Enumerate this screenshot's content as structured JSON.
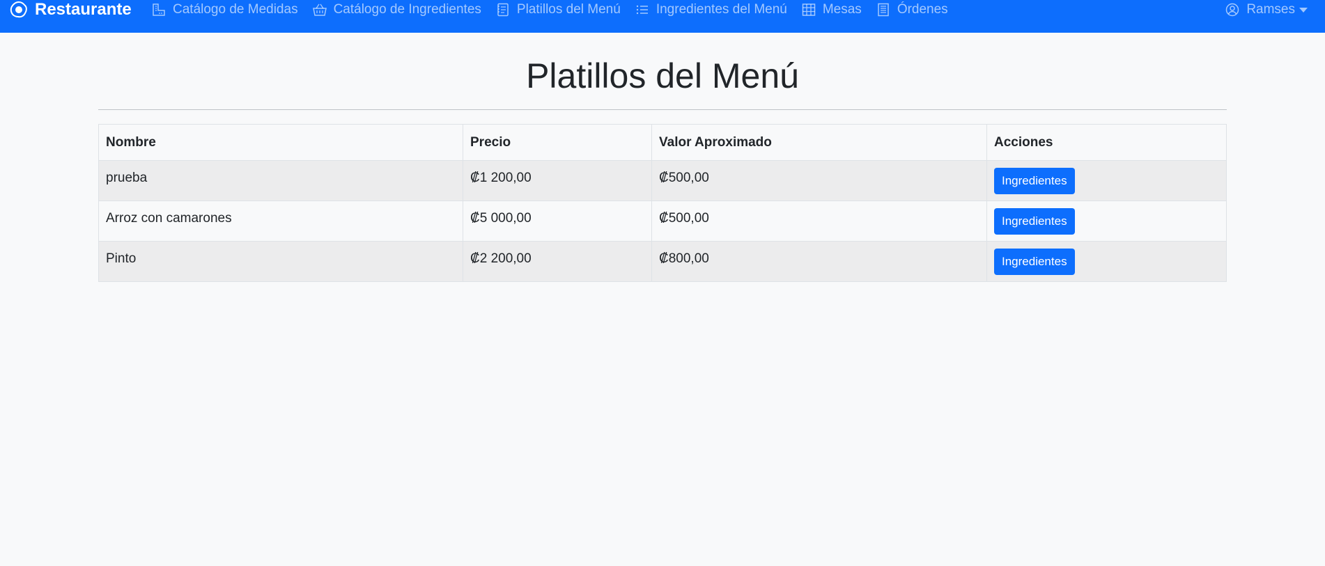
{
  "navbar": {
    "brand": "Restaurante",
    "items": [
      {
        "label": "Catálogo de Medidas",
        "icon": "ruler-icon"
      },
      {
        "label": "Catálogo de Ingredientes",
        "icon": "basket-icon"
      },
      {
        "label": "Platillos del Menú",
        "icon": "journal-icon"
      },
      {
        "label": "Ingredientes del Menú",
        "icon": "list-icon"
      },
      {
        "label": "Mesas",
        "icon": "table-grid-icon"
      },
      {
        "label": "Órdenes",
        "icon": "receipt-icon"
      }
    ],
    "user": "Ramses"
  },
  "page": {
    "title": "Platillos del Menú"
  },
  "table": {
    "headers": [
      "Nombre",
      "Precio",
      "Valor Aproximado",
      "Acciones"
    ],
    "rows": [
      {
        "nombre": "prueba",
        "precio": "₡1 200,00",
        "valor": "₡500,00",
        "action": "Ingredientes"
      },
      {
        "nombre": "Arroz con camarones",
        "precio": "₡5 000,00",
        "valor": "₡500,00",
        "action": "Ingredientes"
      },
      {
        "nombre": "Pinto",
        "precio": "₡2 200,00",
        "valor": "₡800,00",
        "action": "Ingredientes"
      }
    ]
  },
  "colors": {
    "primary": "#0d6efd",
    "background": "#f8f9fa",
    "stripe": "#ececed"
  }
}
